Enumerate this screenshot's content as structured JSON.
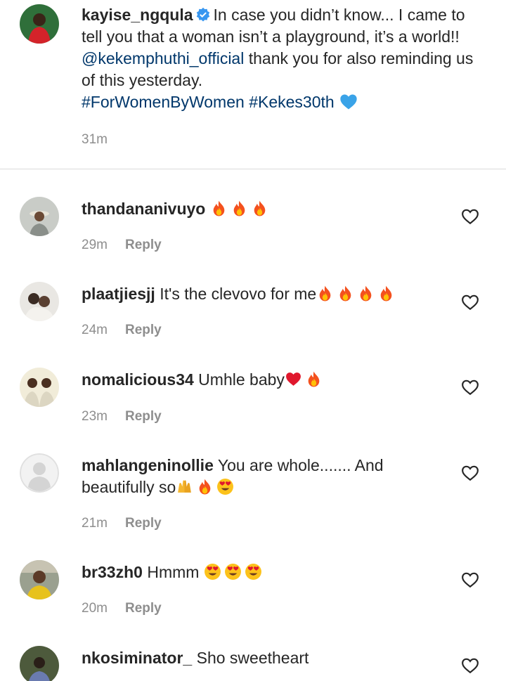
{
  "caption": {
    "username": "kayise_ngqula",
    "text_before": "In case you didn’t know... I came to tell you that a woman isn’t a playground, it’s a world!! ",
    "mention": "@kekemphuthi_official",
    "text_after": " thank you for also reminding us of this yesterday.",
    "hashtag1": "#ForWomenByWomen",
    "hashtag2": "#Kekes30th",
    "time": "31m",
    "icons": [
      "verified-badge-icon",
      "blue-heart-icon"
    ]
  },
  "comments": [
    {
      "username": "thandananivuyo",
      "text": "",
      "time": "29m",
      "reply": "Reply",
      "emoji": [
        "fire",
        "fire",
        "fire"
      ]
    },
    {
      "username": "plaatjiesjj",
      "text": "It's the clevovo for me",
      "time": "24m",
      "reply": "Reply",
      "emoji": [
        "fire",
        "fire",
        "fire",
        "fire"
      ]
    },
    {
      "username": "nomalicious34",
      "text": "Umhle baby",
      "time": "23m",
      "reply": "Reply",
      "emoji": [
        "red-heart",
        "fire"
      ]
    },
    {
      "username": "mahlangeninollie",
      "text": "You are whole....... And",
      "text2": "beautifully so",
      "time": "21m",
      "reply": "Reply",
      "emoji": [
        "raising-hands",
        "fire",
        "heart-eyes"
      ]
    },
    {
      "username": "br33zh0",
      "text": "Hmmm",
      "time": "20m",
      "reply": "Reply",
      "emoji": [
        "heart-eyes",
        "heart-eyes",
        "heart-eyes"
      ]
    },
    {
      "username": "nkosiminator_",
      "text": "Sho sweetheart",
      "emoji": []
    }
  ],
  "colors": {
    "link": "#00376b",
    "muted": "#8e8e8e",
    "text": "#262626",
    "verified": "#3897f0"
  }
}
